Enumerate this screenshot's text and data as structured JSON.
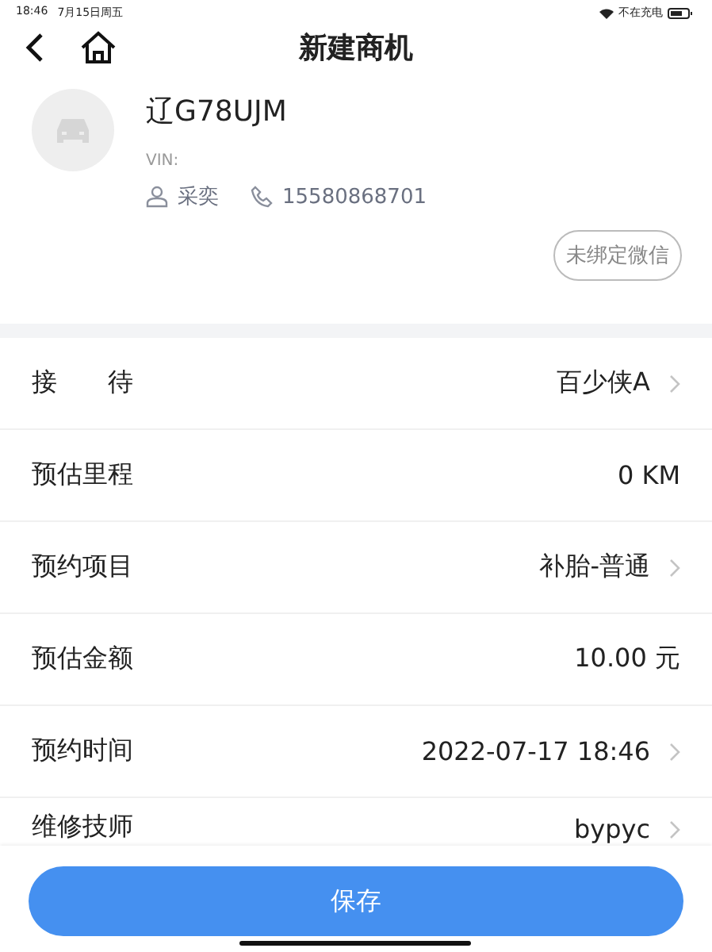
{
  "status_bar": {
    "time": "18:46",
    "date": "7月15日周五",
    "charging": "不在充电"
  },
  "nav": {
    "title": "新建商机"
  },
  "vehicle": {
    "plate": "辽G78UJM",
    "vin_label": "VIN:",
    "owner": "采奕",
    "phone": "15580868701",
    "wechat_badge": "未绑定微信"
  },
  "fields": [
    {
      "label": "接　　待",
      "value": "百少侠A",
      "kind": "select"
    },
    {
      "label": "预估里程",
      "value": "0  KM",
      "kind": "text"
    },
    {
      "label": "预约项目",
      "value": "补胎-普通",
      "kind": "select"
    },
    {
      "label": "预估金额",
      "value": "10.00  元",
      "kind": "text"
    },
    {
      "label": "预约时间",
      "value": "2022-07-17 18:46",
      "kind": "select"
    },
    {
      "label": "维修技师",
      "value": "bypyc",
      "kind": "select"
    }
  ],
  "save_button": "保存"
}
